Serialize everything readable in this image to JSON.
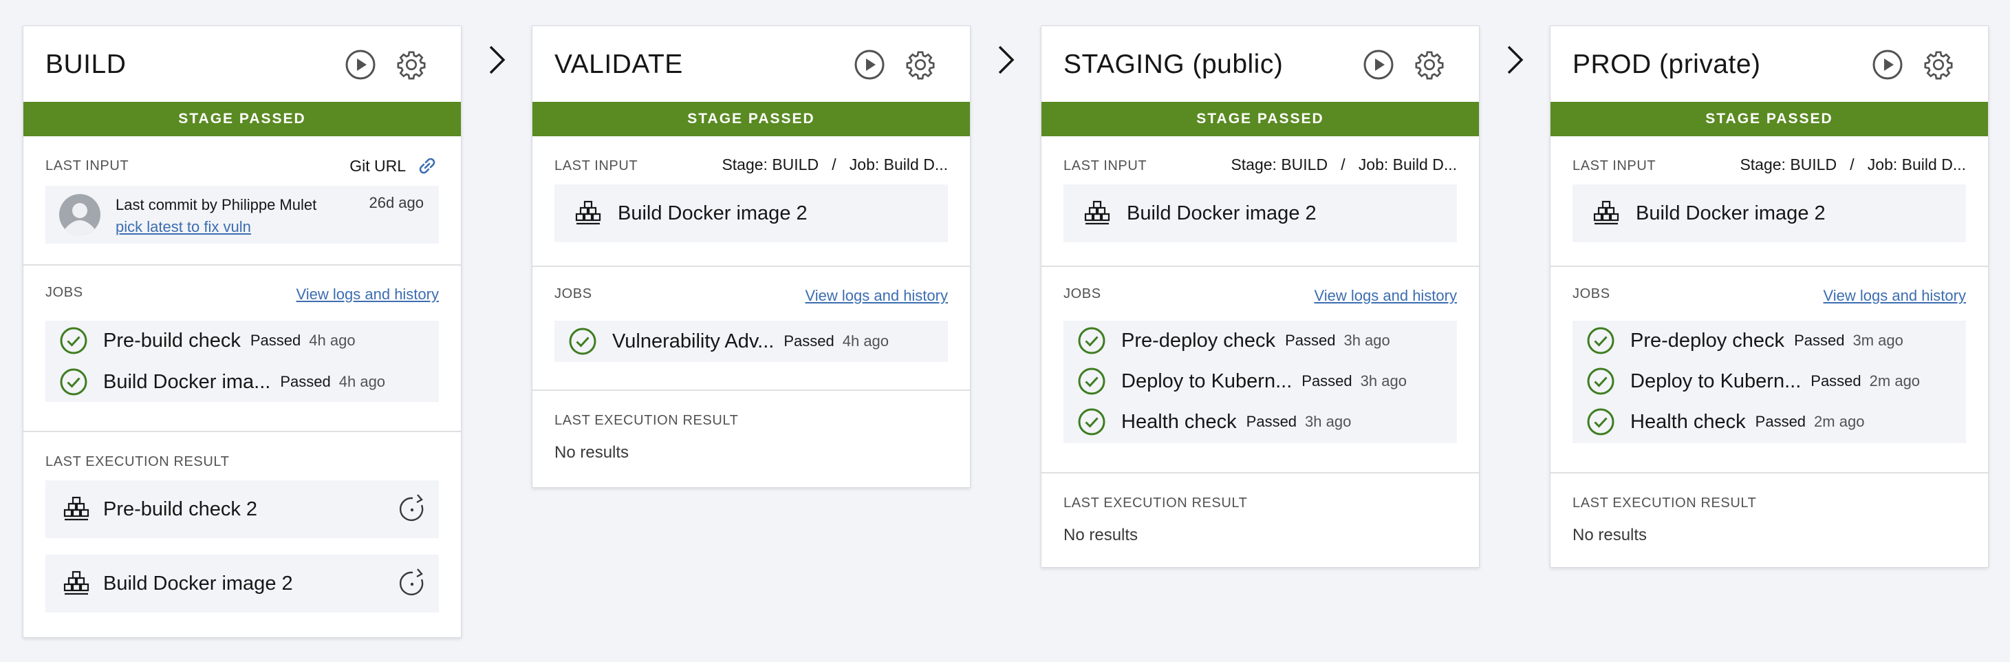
{
  "stages": [
    {
      "title": "BUILD",
      "banner": "STAGE PASSED",
      "last_input_label": "LAST INPUT",
      "last_input_source": "Git URL",
      "commit": {
        "author_line": "Last commit by Philippe Mulet",
        "message": "pick latest to fix vuln",
        "age": "26d ago"
      },
      "jobs_label": "JOBS",
      "jobs_link": "View logs and history",
      "jobs": [
        {
          "name": "Pre-build check",
          "status": "Passed",
          "time": "4h ago"
        },
        {
          "name": "Build Docker ima...",
          "status": "Passed",
          "time": "4h ago"
        }
      ],
      "result_label": "LAST EXECUTION RESULT",
      "results": [
        "Pre-build check 2",
        "Build Docker image 2"
      ]
    },
    {
      "title": "VALIDATE",
      "banner": "STAGE PASSED",
      "last_input_label": "LAST INPUT",
      "last_input_source": "Stage: BUILD   /   Job: Build D...",
      "input_item": "Build Docker image 2",
      "jobs_label": "JOBS",
      "jobs_link": "View logs and history",
      "jobs": [
        {
          "name": "Vulnerability Adv...",
          "status": "Passed",
          "time": "4h ago"
        }
      ],
      "result_label": "LAST EXECUTION RESULT",
      "no_results": "No results"
    },
    {
      "title": "STAGING (public)",
      "banner": "STAGE PASSED",
      "last_input_label": "LAST INPUT",
      "last_input_source": "Stage: BUILD   /   Job: Build D...",
      "input_item": "Build Docker image 2",
      "jobs_label": "JOBS",
      "jobs_link": "View logs and history",
      "jobs": [
        {
          "name": "Pre-deploy check",
          "status": "Passed",
          "time": "3h ago"
        },
        {
          "name": "Deploy to Kubern...",
          "status": "Passed",
          "time": "3h ago"
        },
        {
          "name": "Health check",
          "status": "Passed",
          "time": "3h ago"
        }
      ],
      "result_label": "LAST EXECUTION RESULT",
      "no_results": "No results"
    },
    {
      "title": "PROD (private)",
      "banner": "STAGE PASSED",
      "last_input_label": "LAST INPUT",
      "last_input_source": "Stage: BUILD   /   Job: Build D...",
      "input_item": "Build Docker image 2",
      "jobs_label": "JOBS",
      "jobs_link": "View logs and history",
      "jobs": [
        {
          "name": "Pre-deploy check",
          "status": "Passed",
          "time": "3m ago"
        },
        {
          "name": "Deploy to Kubern...",
          "status": "Passed",
          "time": "2m ago"
        },
        {
          "name": "Health check",
          "status": "Passed",
          "time": "2m ago"
        }
      ],
      "result_label": "LAST EXECUTION RESULT",
      "no_results": "No results"
    }
  ],
  "icons": {
    "run": "play-icon",
    "configure": "gear-icon",
    "link": "link-icon",
    "job_passed": "check-circle-icon",
    "artifact": "stacked-blocks-icon",
    "rerun": "rerun-icon",
    "connector": "chevron-right-icon"
  },
  "colors": {
    "stage_passed": "#5a8a22",
    "check": "#3f7d20",
    "link": "#3c6db0",
    "background": "#f3f4f8"
  }
}
